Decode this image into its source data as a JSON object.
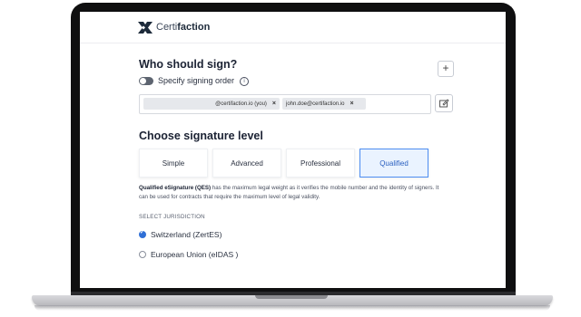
{
  "header": {
    "brand_light": "Certi",
    "brand_bold": "faction",
    "logo_icon": "certifaction-logo-icon"
  },
  "signers": {
    "title": "Who should sign?",
    "add_icon": "plus-icon",
    "toggle_label": "Specify signing order",
    "info_icon": "info-icon",
    "chips": [
      {
        "email": "@certifaction.io (you)",
        "remove": "×"
      },
      {
        "email": "john.doe@certifaction.io",
        "remove": "×"
      }
    ],
    "edit_icon": "edit-icon"
  },
  "signature_level": {
    "title": "Choose signature level",
    "options": [
      "Simple",
      "Advanced",
      "Professional",
      "Qualified"
    ],
    "selected": "Qualified",
    "description_bold": "Qualified eSignature (QES)",
    "description_rest": " has the maximum legal weight as it verifies the mobile number and the identity of signers. It can be used for contracts that require the maximum level of legal validity."
  },
  "jurisdiction": {
    "label": "SELECT JURISDICTION",
    "options": [
      {
        "label": "Switzerland (ZertES)",
        "selected": true
      },
      {
        "label": "European Union (eIDAS )",
        "selected": false
      }
    ]
  },
  "colors": {
    "accent": "#2f6fd6",
    "selected_bg": "#eaf3ff",
    "text_dark": "#1b2233"
  }
}
